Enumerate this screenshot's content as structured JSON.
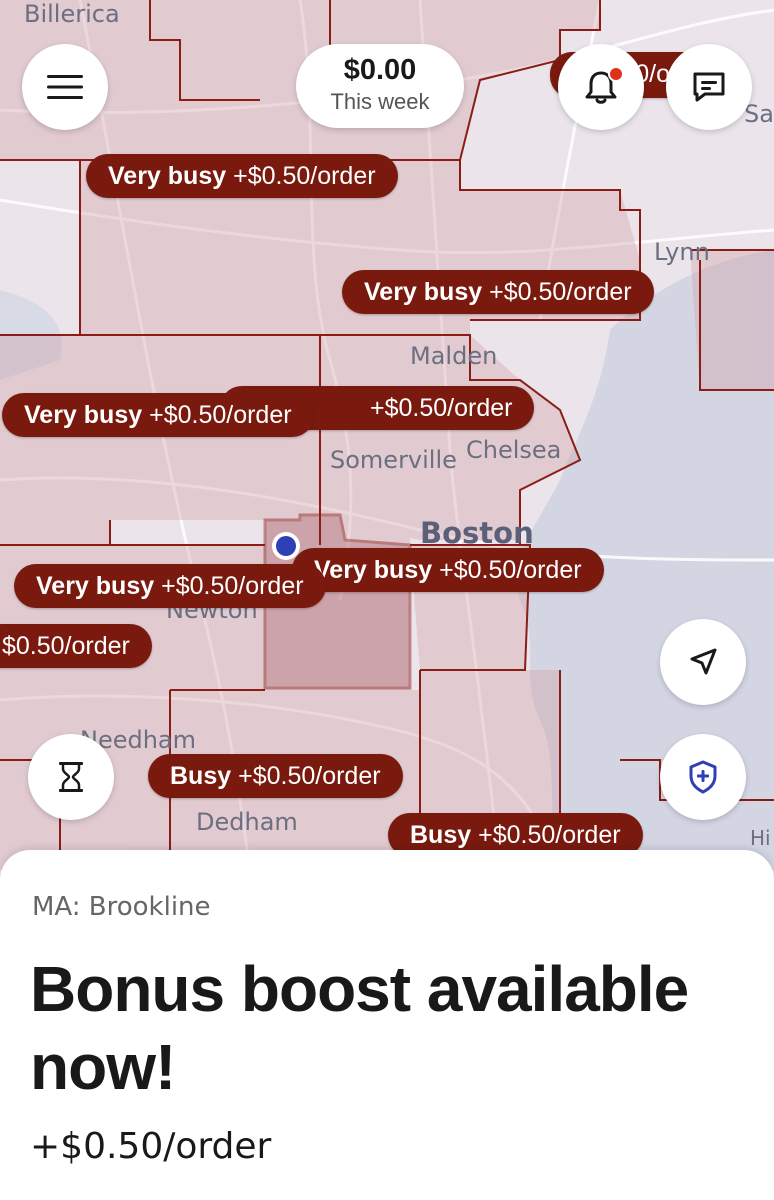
{
  "header": {
    "earnings_amount": "$0.00",
    "earnings_period": "This week"
  },
  "icons": {
    "menu": "hamburger-menu-icon",
    "notifications": "bell-icon",
    "messages": "chat-icon",
    "recenter": "navigation-arrow-icon",
    "timer": "hourglass-icon",
    "safety": "shield-plus-icon"
  },
  "colors": {
    "zone_fill": "#c98f96",
    "zone_border": "#8a1d14",
    "pill_bg": "#7a1a0f",
    "water": "#d3d4e2",
    "notification_dot": "#e0321b"
  },
  "map": {
    "places": [
      "Billerica",
      "Lynn",
      "Malden",
      "Somerville",
      "Chelsea",
      "Boston",
      "Newton",
      "Needham",
      "Dedham",
      "Sa",
      "Hi"
    ],
    "zone_labels": [
      {
        "level": "Very busy",
        "bonus": "+$0.50/order"
      },
      {
        "level": "Very busy",
        "bonus": "+$0.50/order"
      },
      {
        "level": "Very busy",
        "bonus": "+$0.50/order"
      },
      {
        "level": "Very busy",
        "bonus": "+$0.50/order"
      },
      {
        "level": "Very busy",
        "bonus": "+$0.50/order"
      },
      {
        "level": "Very busy",
        "bonus": "+$0.50/order"
      },
      {
        "level": "",
        "bonus": "+$0.50/order"
      },
      {
        "level": "",
        "bonus": "$0.50/order"
      },
      {
        "level": "Busy",
        "bonus": "+$0.50/order"
      },
      {
        "level": "Busy",
        "bonus": "+$0.50/order"
      }
    ]
  },
  "sheet": {
    "location": "MA: Brookline",
    "headline": "Bonus boost available now!",
    "bonus": "+$0.50/order"
  }
}
